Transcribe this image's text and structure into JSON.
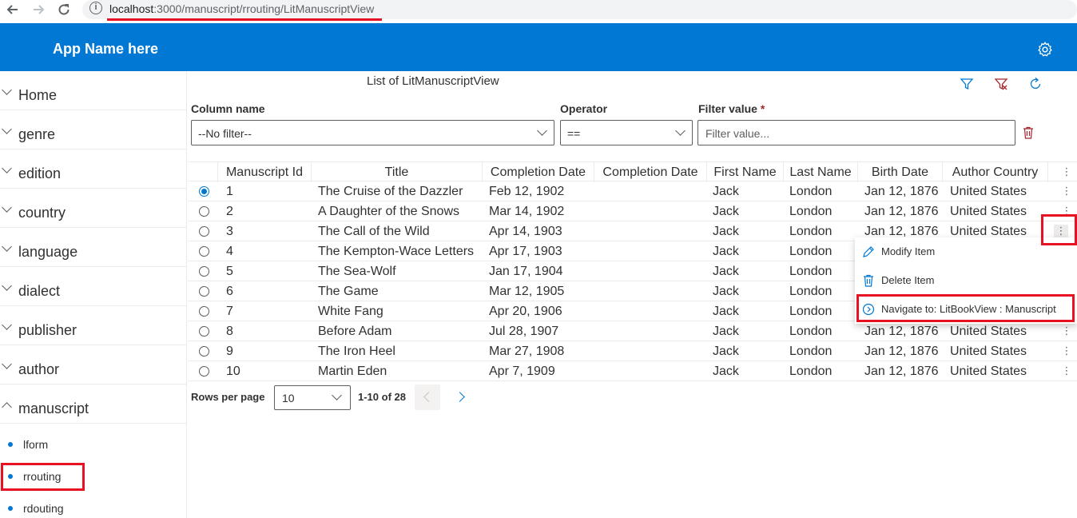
{
  "browser": {
    "url_host": "localhost",
    "url_path": ":3000/manuscript/rrouting/LitManuscriptView",
    "back_icon": "arrow-left-icon",
    "forward_icon": "arrow-right-icon",
    "reload_icon": "reload-icon"
  },
  "header": {
    "app_title": "App Name here",
    "settings_icon": "gear-icon",
    "background": "#0078d4"
  },
  "sidebar": {
    "items": [
      {
        "label": "Home"
      },
      {
        "label": "genre"
      },
      {
        "label": "edition"
      },
      {
        "label": "country"
      },
      {
        "label": "language"
      },
      {
        "label": "dialect"
      },
      {
        "label": "publisher"
      },
      {
        "label": "author"
      },
      {
        "label": "manuscript"
      }
    ],
    "sub_items": [
      {
        "label": "lform"
      },
      {
        "label": "rrouting"
      },
      {
        "label": "rdouting"
      }
    ]
  },
  "main": {
    "title": "List of LitManuscriptView",
    "filter": {
      "column_label": "Column name",
      "column_value": "--No filter--",
      "operator_label": "Operator",
      "operator_value": "==",
      "value_label": "Filter value",
      "value_required": "*",
      "value_placeholder": "Filter value..."
    },
    "table": {
      "columns": [
        "Manuscript Id",
        "Title",
        "Completion Date",
        "Completion Date",
        "First Name",
        "Last Name",
        "Birth Date",
        "Author Country"
      ],
      "rows": [
        {
          "id": "1",
          "title": "The Cruise of the Dazzler",
          "cdate": "Feb 12, 1902",
          "cdate2": "",
          "first": "Jack",
          "last": "London",
          "birth": "Jan 12, 1876",
          "country": "United States",
          "selected": true
        },
        {
          "id": "2",
          "title": "A Daughter of the Snows",
          "cdate": "Mar 14, 1902",
          "cdate2": "",
          "first": "Jack",
          "last": "London",
          "birth": "Jan 12, 1876",
          "country": "United States",
          "selected": false
        },
        {
          "id": "3",
          "title": "The Call of the Wild",
          "cdate": "Apr 14, 1903",
          "cdate2": "",
          "first": "Jack",
          "last": "London",
          "birth": "Jan 12, 1876",
          "country": "United States",
          "selected": false
        },
        {
          "id": "4",
          "title": "The Kempton-Wace Letters",
          "cdate": "Apr 17, 1903",
          "cdate2": "",
          "first": "Jack",
          "last": "London",
          "birth": "",
          "country": "",
          "selected": false
        },
        {
          "id": "5",
          "title": "The Sea-Wolf",
          "cdate": "Jan 17, 1904",
          "cdate2": "",
          "first": "Jack",
          "last": "London",
          "birth": "",
          "country": "",
          "selected": false
        },
        {
          "id": "6",
          "title": "The Game",
          "cdate": "Mar 12, 1905",
          "cdate2": "",
          "first": "Jack",
          "last": "London",
          "birth": "",
          "country": "",
          "selected": false
        },
        {
          "id": "7",
          "title": "White Fang",
          "cdate": "Apr 20, 1906",
          "cdate2": "",
          "first": "Jack",
          "last": "London",
          "birth": "",
          "country": "",
          "selected": false
        },
        {
          "id": "8",
          "title": "Before Adam",
          "cdate": "Jul 28, 1907",
          "cdate2": "",
          "first": "Jack",
          "last": "London",
          "birth": "Jan 12, 1876",
          "country": "United States",
          "selected": false
        },
        {
          "id": "9",
          "title": "The Iron Heel",
          "cdate": "Mar 27, 1908",
          "cdate2": "",
          "first": "Jack",
          "last": "London",
          "birth": "Jan 12, 1876",
          "country": "United States",
          "selected": false
        },
        {
          "id": "10",
          "title": "Martin Eden",
          "cdate": "Apr 7, 1909",
          "cdate2": "",
          "first": "Jack",
          "last": "London",
          "birth": "Jan 12, 1876",
          "country": "United States",
          "selected": false
        }
      ]
    },
    "context_menu": {
      "items": [
        {
          "label": "Modify Item",
          "icon": "edit-icon"
        },
        {
          "label": "Delete Item",
          "icon": "trash-icon"
        },
        {
          "label": "Navigate to: LitBookView : Manuscript",
          "icon": "navigate-icon"
        }
      ]
    },
    "pagination": {
      "rows_per_page_label": "Rows per page",
      "rows_per_page_value": "10",
      "range_text": "1-10 of 28"
    }
  },
  "colors": {
    "accent": "#0078d4",
    "highlight": "#e81123",
    "danger": "#a4262c"
  }
}
